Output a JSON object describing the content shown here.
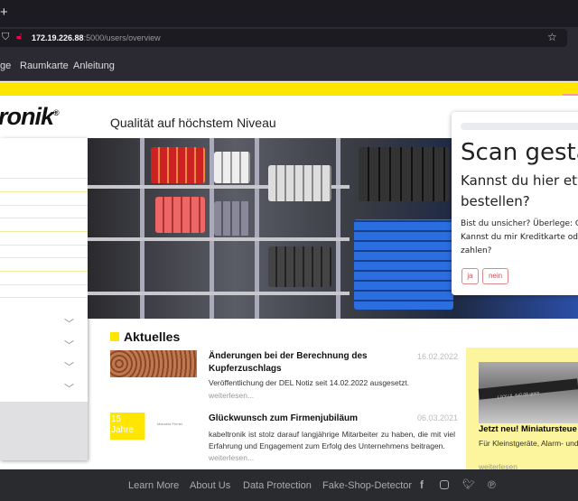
{
  "browser": {
    "new_tab": "+",
    "url_host": "172.19.226.88",
    "url_path": ":5000/users/overview",
    "bookmarks": [
      "ge",
      "Raumkarte",
      "Anleitung"
    ]
  },
  "header": {
    "logo": "ronik",
    "registered": "®",
    "tagline": "Qualität auf höchstem Niveau"
  },
  "popup": {
    "title": "Scan gestar",
    "question": "Kannst du hier etwa",
    "question2": "bestellen?",
    "hint1": "Bist du unsicher? Überlege: G",
    "hint2": "Kannst du mir Kreditkarte od",
    "hint3": "zahlen?",
    "yes": "ja",
    "no": "nein",
    "progress": 0
  },
  "news": {
    "heading": "Aktuelles",
    "items": [
      {
        "title": "Änderungen bei der Berechnung des Kupferzuschlags",
        "date": "16.02.2022",
        "text": "Veröffentlichung der DEL Notiz seit 14.02.2022 ausgesetzt.",
        "more": "weiterlesen..."
      },
      {
        "title": "Glückwunsch zum Firmenjubiläum",
        "date": "06.03.2021",
        "text": "kabeltronik ist stolz darauf langjährige Mitarbeiter zu haben, die mit viel Erfahrung und Engagement zum Erfolg des Unternehmens beitragen.",
        "more": "weiterlesen...",
        "thumb_text": "15 Jahre",
        "thumb_name": "Manuela Ferner"
      }
    ]
  },
  "promo": {
    "cable_label": "LiYY-UL 4x0,08 qmm",
    "title": "Jetzt neu! Miniatursteue",
    "text": "Für Kleinstgeräte, Alarm- und etc.,",
    "more": "weiterlesen"
  },
  "footer": {
    "links": [
      "Learn More",
      "About Us",
      "Data Protection",
      "Fake-Shop-Detector"
    ],
    "social": [
      "facebook-icon",
      "instagram-icon",
      "twitter-icon",
      "pinterest-icon"
    ]
  },
  "colors": {
    "brand_yellow": "#ffe600",
    "footer_bg": "#2a2b2e",
    "button_red": "#cc5555"
  }
}
